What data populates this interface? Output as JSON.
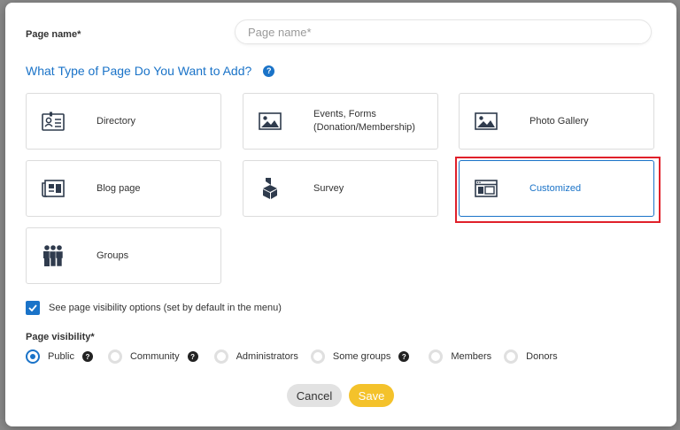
{
  "page_name": {
    "label": "Page name*",
    "placeholder": "Page name*"
  },
  "type_section": {
    "heading": "What Type of Page Do You Want to Add?",
    "help_icon": "?",
    "cards": [
      {
        "id": "directory",
        "label": "Directory",
        "icon": "contact-card-icon",
        "selected": false
      },
      {
        "id": "events-forms",
        "label": "Events, Forms\n(Donation/Membership)",
        "icon": "image-icon",
        "selected": false
      },
      {
        "id": "photo-gallery",
        "label": "Photo Gallery",
        "icon": "image-icon",
        "selected": false
      },
      {
        "id": "blog-page",
        "label": "Blog page",
        "icon": "newspaper-icon",
        "selected": false
      },
      {
        "id": "survey",
        "label": "Survey",
        "icon": "ballot-box-icon",
        "selected": false
      },
      {
        "id": "customized",
        "label": "Customized",
        "icon": "layout-icon",
        "selected": true
      },
      {
        "id": "groups",
        "label": "Groups",
        "icon": "people-group-icon",
        "selected": false
      }
    ]
  },
  "visibility_options_checkbox": {
    "label": "See page visibility options (set by default in the menu)",
    "checked": true
  },
  "visibility": {
    "label": "Page visibility*",
    "options": [
      {
        "label": "Public",
        "checked": true,
        "help": true
      },
      {
        "label": "Community",
        "checked": false,
        "help": true
      },
      {
        "label": "Administrators",
        "checked": false,
        "help": false
      },
      {
        "label": "Some groups",
        "checked": false,
        "help": true
      },
      {
        "label": "Members",
        "checked": false,
        "help": false
      },
      {
        "label": "Donors",
        "checked": false,
        "help": false
      }
    ]
  },
  "buttons": {
    "cancel": "Cancel",
    "save": "Save"
  },
  "colors": {
    "accent": "#1a73c8",
    "save": "#f4c22b",
    "highlight": "#e0202a",
    "icon": "#2f3b4d"
  }
}
